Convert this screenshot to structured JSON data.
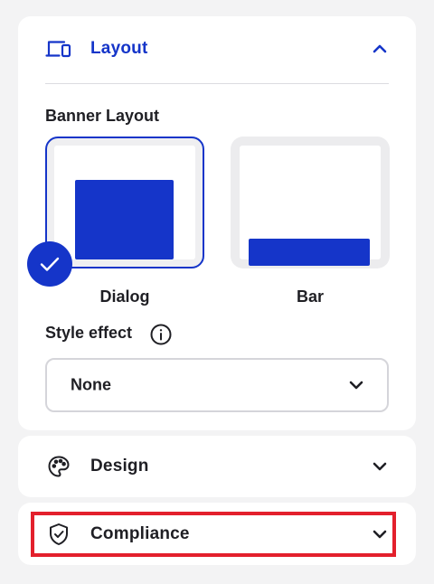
{
  "sections": {
    "layout": {
      "label": "Layout",
      "icon": "devices-icon",
      "expanded": true
    },
    "design": {
      "label": "Design",
      "icon": "palette-icon",
      "expanded": false
    },
    "compliance": {
      "label": "Compliance",
      "icon": "shield-check-icon",
      "expanded": false,
      "highlighted": true
    }
  },
  "banner_layout": {
    "label": "Banner Layout",
    "options": [
      {
        "label": "Dialog",
        "selected": true
      },
      {
        "label": "Bar",
        "selected": false
      }
    ]
  },
  "style_effect": {
    "label": "Style effect",
    "value": "None"
  },
  "colors": {
    "accent": "#1535c9",
    "highlight": "#e3202c",
    "background": "#f3f3f4"
  }
}
